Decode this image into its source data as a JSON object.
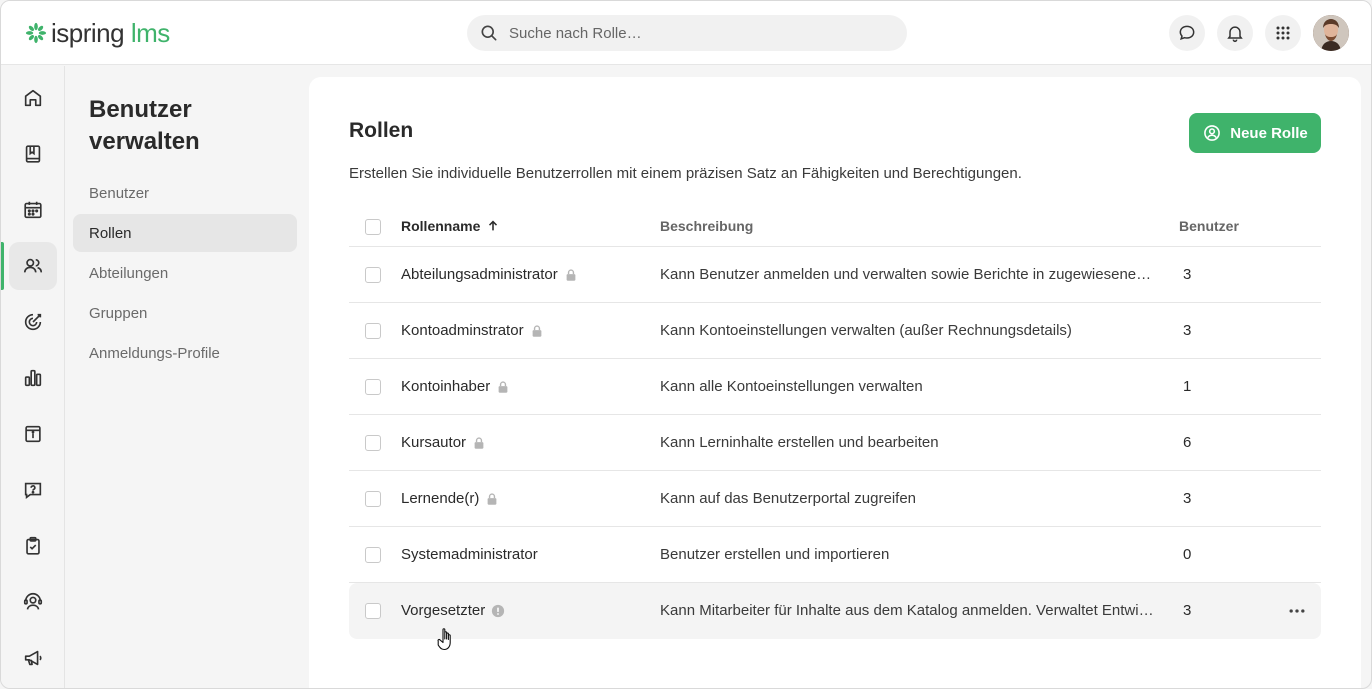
{
  "app": {
    "logo_text": "ispring",
    "logo_suffix": "lms",
    "brand_color": "#3fb36b"
  },
  "search": {
    "placeholder": "Suche nach Rolle…"
  },
  "topbar_icons": [
    "chat-icon",
    "bell-icon",
    "apps-grid-icon",
    "user-avatar"
  ],
  "rail": {
    "items": [
      {
        "icon": "home-icon"
      },
      {
        "icon": "book-icon"
      },
      {
        "icon": "calendar-icon"
      },
      {
        "icon": "users-icon",
        "active": true
      },
      {
        "icon": "target-icon"
      },
      {
        "icon": "bar-chart-icon"
      },
      {
        "icon": "info-panel-icon"
      },
      {
        "icon": "question-chat-icon"
      },
      {
        "icon": "clipboard-check-icon"
      },
      {
        "icon": "support-agent-icon"
      },
      {
        "icon": "megaphone-icon"
      }
    ]
  },
  "subnav": {
    "title": "Benutzer verwalten",
    "items": [
      {
        "label": "Benutzer"
      },
      {
        "label": "Rollen",
        "active": true
      },
      {
        "label": "Abteilungen"
      },
      {
        "label": "Gruppen"
      },
      {
        "label": "Anmeldungs-Profile"
      }
    ]
  },
  "main": {
    "title": "Rollen",
    "description": "Erstellen Sie individuelle Benutzerrollen mit einem präzisen Satz an Fähigkeiten und Berechtigungen.",
    "new_button_label": "Neue Rolle",
    "table": {
      "columns": [
        "Rollenname",
        "Beschreibung",
        "Benutzer"
      ],
      "rows": [
        {
          "name": "Abteilungsadministrator",
          "icon": "lock-icon",
          "description": "Kann Benutzer anmelden und verwalten sowie Berichte in zugewiesenen …",
          "users": "3"
        },
        {
          "name": "Kontoadminstrator",
          "icon": "lock-icon",
          "description": "Kann Kontoeinstellungen verwalten (außer Rechnungsdetails)",
          "users": "3"
        },
        {
          "name": "Kontoinhaber",
          "icon": "lock-icon",
          "description": "Kann alle Kontoeinstellungen verwalten",
          "users": "1"
        },
        {
          "name": "Kursautor",
          "icon": "lock-icon",
          "description": "Kann Lerninhalte erstellen und bearbeiten",
          "users": "6"
        },
        {
          "name": "Lernende(r)",
          "icon": "lock-icon",
          "description": "Kann auf das Benutzerportal zugreifen",
          "users": "3"
        },
        {
          "name": "Systemadministrator",
          "icon": "",
          "description": "Benutzer erstellen und importieren",
          "users": "0"
        },
        {
          "name": "Vorgesetzter",
          "icon": "info-icon",
          "description": "Kann Mitarbeiter für Inhalte aus dem Katalog anmelden. Verwaltet Entwi…",
          "users": "3"
        }
      ]
    }
  }
}
